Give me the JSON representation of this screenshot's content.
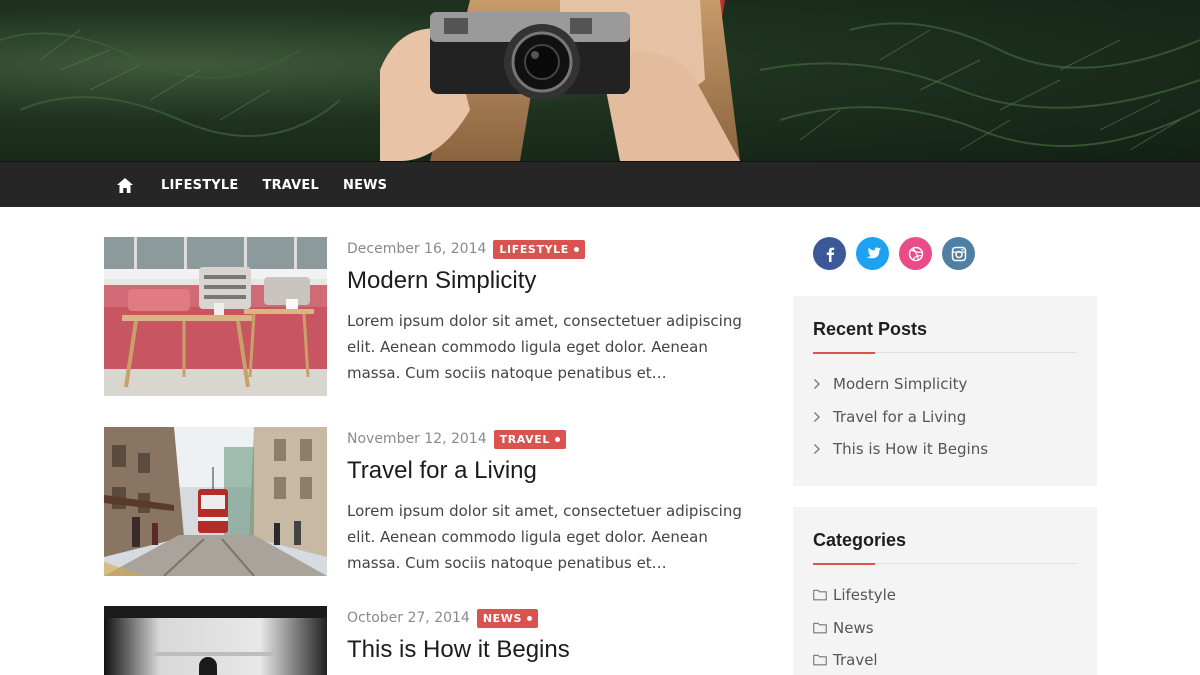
{
  "nav": {
    "items": [
      {
        "label": "LIFESTYLE"
      },
      {
        "label": "TRAVEL"
      },
      {
        "label": "NEWS"
      }
    ]
  },
  "posts": [
    {
      "date": "December 16, 2014",
      "category": "LIFESTYLE",
      "title": "Modern Simplicity",
      "excerpt": "Lorem ipsum dolor sit amet, consectetuer adipiscing elit. Aenean commodo ligula eget dolor. Aenean massa. Cum sociis natoque penatibus et…"
    },
    {
      "date": "November 12, 2014",
      "category": "TRAVEL",
      "title": "Travel for a Living",
      "excerpt": "Lorem ipsum dolor sit amet, consectetuer adipiscing elit. Aenean commodo ligula eget dolor. Aenean massa. Cum sociis natoque penatibus et…"
    },
    {
      "date": "October 27, 2014",
      "category": "NEWS",
      "title": "This is How it Begins"
    }
  ],
  "sidebar": {
    "social": [
      {
        "icon": "facebook-icon",
        "color": "#3b5998"
      },
      {
        "icon": "twitter-icon",
        "color": "#1da1f2"
      },
      {
        "icon": "dribbble-icon",
        "color": "#ea4c89"
      },
      {
        "icon": "instagram-icon",
        "color": "#517fa4"
      }
    ],
    "recent_posts": {
      "title": "Recent Posts",
      "items": [
        {
          "label": "Modern Simplicity"
        },
        {
          "label": "Travel for a Living"
        },
        {
          "label": "This is How it Begins"
        }
      ]
    },
    "categories": {
      "title": "Categories",
      "items": [
        {
          "label": "Lifestyle"
        },
        {
          "label": "News"
        },
        {
          "label": "Travel"
        }
      ]
    }
  },
  "colors": {
    "accent": "#d9534f",
    "nav_bg": "#262626",
    "widget_bg": "#f4f4f4"
  }
}
